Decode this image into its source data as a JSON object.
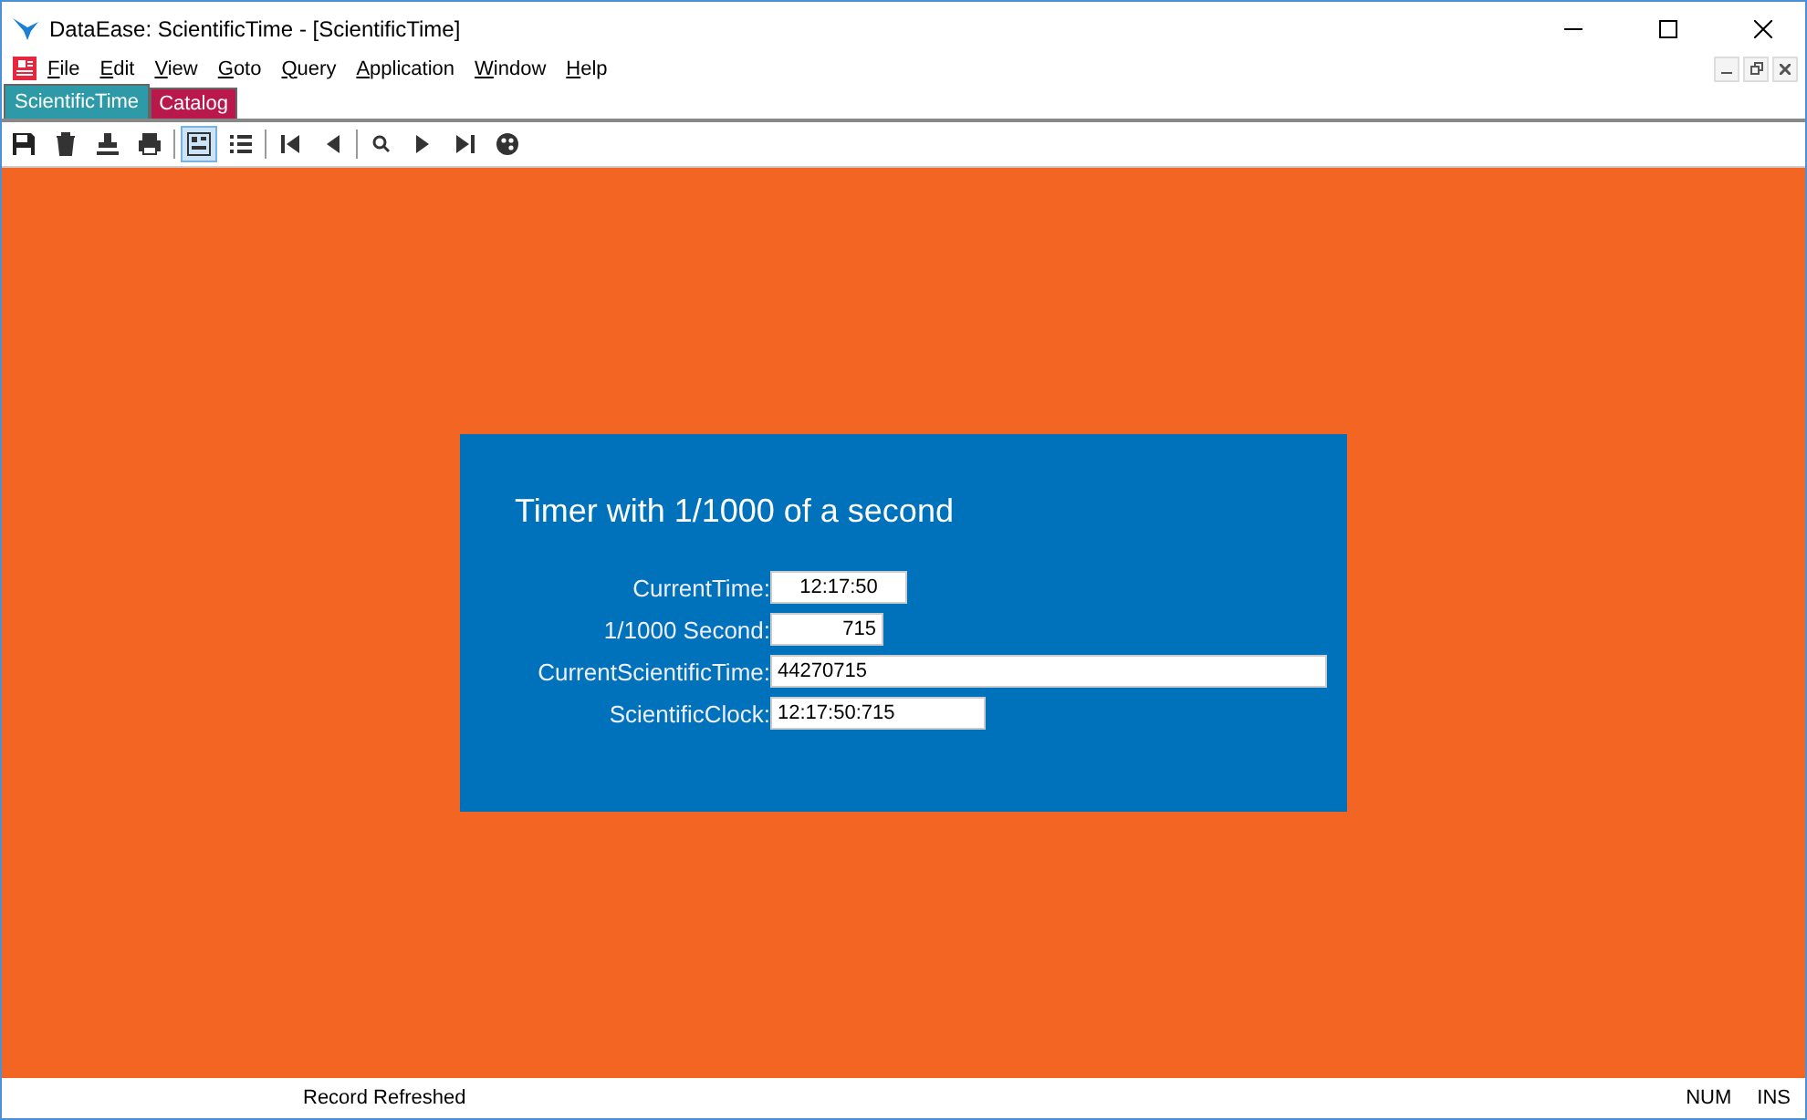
{
  "window": {
    "title": "DataEase: ScientificTime - [ScientificTime]"
  },
  "menu": [
    "File",
    "Edit",
    "View",
    "Goto",
    "Query",
    "Application",
    "Window",
    "Help"
  ],
  "tabs": [
    {
      "label": "ScientificTime",
      "color": "#2e9aa8",
      "selected": true
    },
    {
      "label": "Catalog",
      "color": "#b8194a",
      "selected": false
    }
  ],
  "toolbar": [
    {
      "kind": "save",
      "selected": false
    },
    {
      "kind": "delete",
      "selected": false
    },
    {
      "kind": "stamp",
      "selected": false
    },
    {
      "kind": "print",
      "selected": false
    },
    {
      "kind": "separator"
    },
    {
      "kind": "form",
      "selected": true
    },
    {
      "kind": "list",
      "selected": false
    },
    {
      "kind": "separator"
    },
    {
      "kind": "first",
      "selected": false
    },
    {
      "kind": "prev",
      "selected": false
    },
    {
      "kind": "separator"
    },
    {
      "kind": "search",
      "selected": false
    },
    {
      "kind": "next",
      "selected": false
    },
    {
      "kind": "last",
      "selected": false
    },
    {
      "kind": "palette",
      "selected": false
    }
  ],
  "form": {
    "title": "Timer with 1/1000 of a second",
    "fields": [
      {
        "label": "CurrentTime:",
        "value": "12:17:50",
        "kind": "time"
      },
      {
        "label": "1/1000 Second:",
        "value": "715",
        "kind": "number"
      },
      {
        "label": "CurrentScientificTime:",
        "value": "44270715",
        "kind": "long"
      },
      {
        "label": "ScientificClock:",
        "value": "12:17:50:715",
        "kind": "clock"
      }
    ]
  },
  "status_bar": {
    "message": "Record Refreshed",
    "indicators": [
      "NUM",
      "INS"
    ]
  }
}
